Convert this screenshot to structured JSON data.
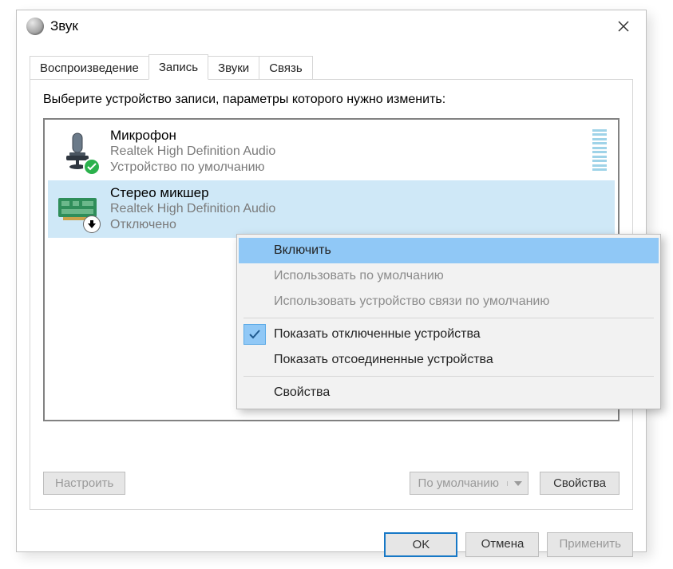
{
  "window": {
    "title": "Звук"
  },
  "tabs": {
    "playback": "Воспроизведение",
    "record": "Запись",
    "sounds": "Звуки",
    "comm": "Связь"
  },
  "hint": "Выберите устройство записи, параметры которого нужно изменить:",
  "devices": [
    {
      "name": "Микрофон",
      "desc": "Realtek High Definition Audio",
      "status": "Устройство по умолчанию"
    },
    {
      "name": "Стерео микшер",
      "desc": "Realtek High Definition Audio",
      "status": "Отключено"
    }
  ],
  "buttons": {
    "configure": "Настроить",
    "default_dd": "По умолчанию",
    "properties": "Свойства",
    "ok": "OK",
    "cancel": "Отмена",
    "apply": "Применить"
  },
  "context_menu": {
    "enable": "Включить",
    "use_default": "Использовать по умолчанию",
    "use_comm_default": "Использовать устройство связи по умолчанию",
    "show_disabled": "Показать отключенные устройства",
    "show_disconnected": "Показать отсоединенные устройства",
    "props": "Свойства"
  }
}
